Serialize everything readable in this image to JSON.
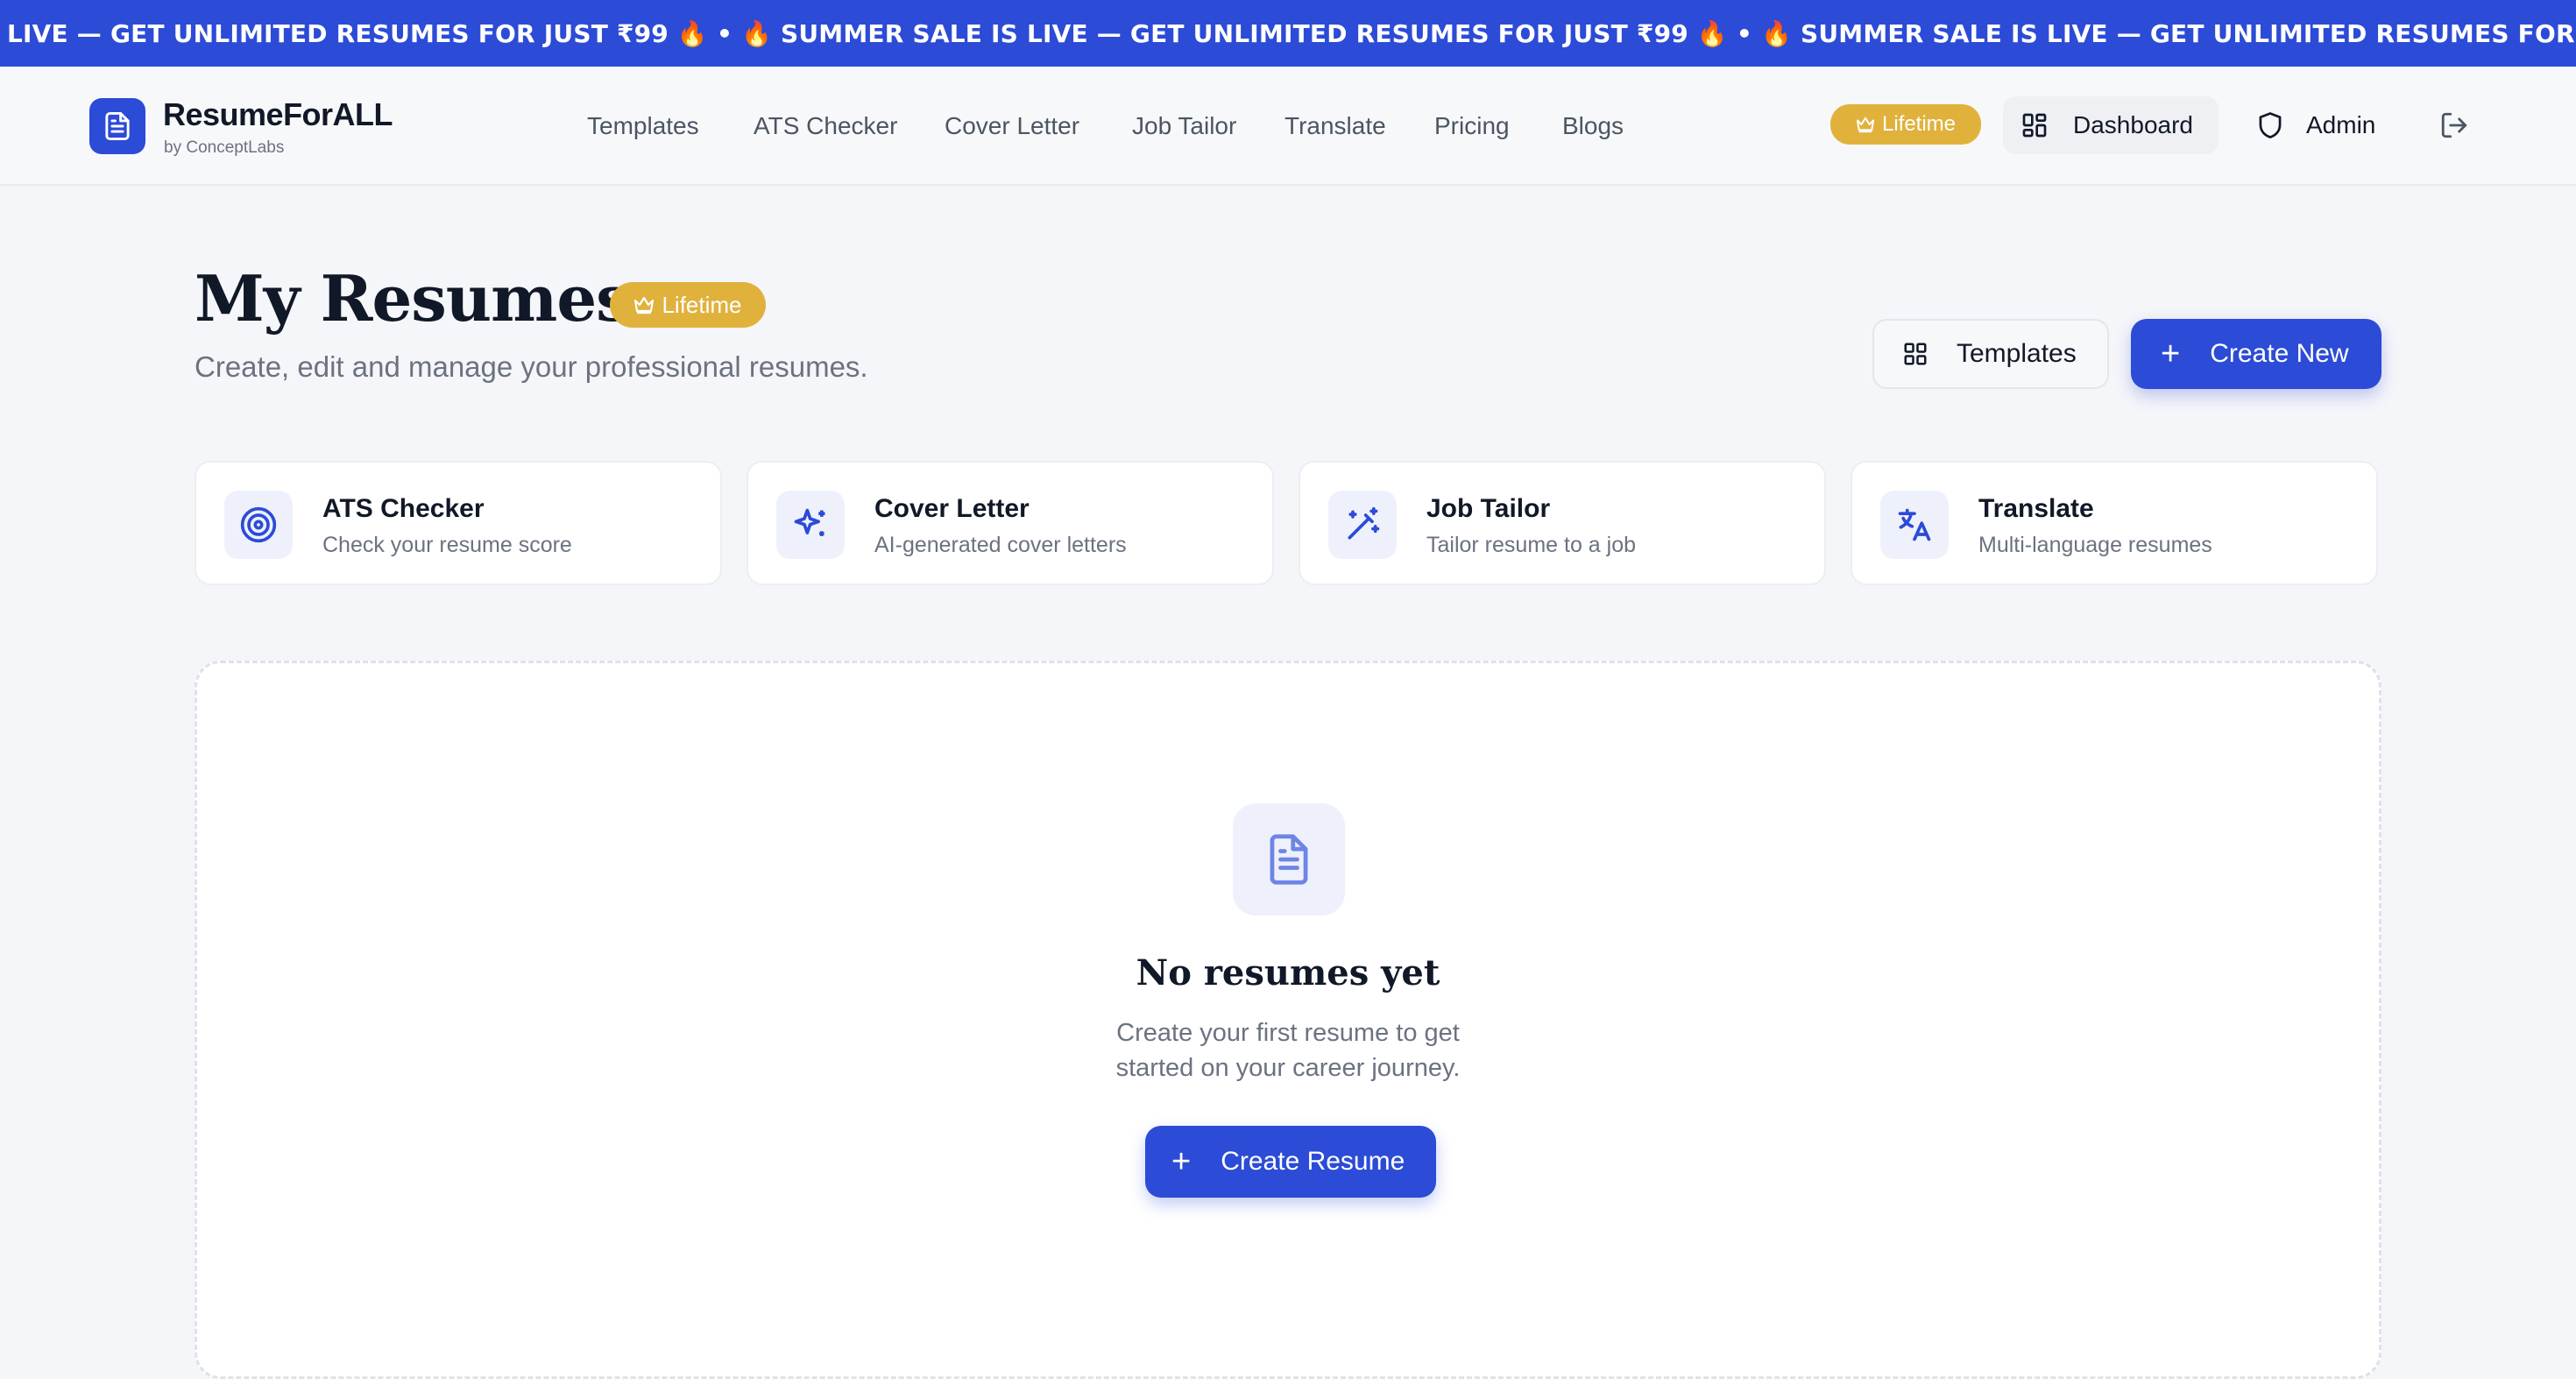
{
  "ticker": {
    "text": "LIVE — GET UNLIMITED RESUMES FOR JUST ₹99 🔥 • 🔥 SUMMER SALE IS LIVE — GET UNLIMITED RESUMES FOR JUST ₹99 🔥 • 🔥 SUMMER SALE IS LIVE — GET UNLIMITED RESUMES FOR JUST ₹99 🔥 • 🔥 SUMMER SALE IS LIVE"
  },
  "nav": {
    "brand": "ResumeForALL",
    "brand_sub": "by ConceptLabs",
    "links": [
      "Templates",
      "ATS Checker",
      "Cover Letter",
      "Job Tailor",
      "Translate",
      "Pricing",
      "Blogs"
    ],
    "badge": "Lifetime",
    "dashboard": "Dashboard",
    "admin": "Admin"
  },
  "header": {
    "title": "My Resumes",
    "badge": "Lifetime",
    "subtitle": "Create, edit and manage your professional resumes.",
    "templates_button": "Templates",
    "create_button": "Create New"
  },
  "tools": [
    {
      "title": "ATS Checker",
      "desc": "Check your resume score",
      "icon": "target-icon"
    },
    {
      "title": "Cover Letter",
      "desc": "AI-generated cover letters",
      "icon": "sparkles-icon"
    },
    {
      "title": "Job Tailor",
      "desc": "Tailor resume to a job",
      "icon": "magic-wand-icon"
    },
    {
      "title": "Translate",
      "desc": "Multi-language resumes",
      "icon": "translate-icon"
    }
  ],
  "empty": {
    "title": "No resumes yet",
    "desc": "Create your first resume to get started on your career journey.",
    "button": "Create Resume",
    "icon": "document-icon"
  },
  "colors": {
    "primary": "#2c4bd6",
    "gold": "#e0b23c",
    "background": "#f5f6f9"
  }
}
